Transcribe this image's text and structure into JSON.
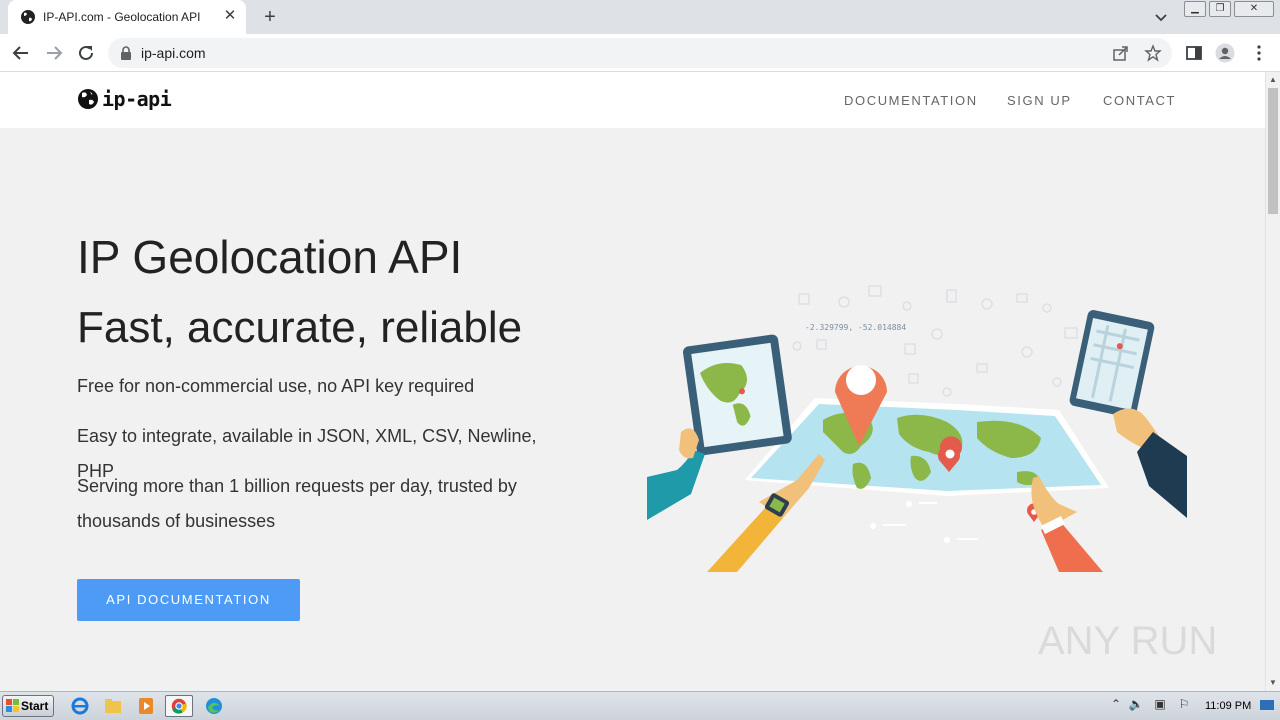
{
  "browser": {
    "tab_title": "IP-API.com - Geolocation API",
    "tab_close": "✕",
    "new_tab": "+",
    "url": "ip-api.com"
  },
  "site": {
    "logo_text": "ip-api",
    "nav": [
      "DOCUMENTATION",
      "SIGN UP",
      "CONTACT"
    ],
    "hero_title": "IP Geolocation API",
    "hero_subtitle": "Fast, accurate, reliable",
    "features": [
      "Free for non-commercial use, no API key required",
      "Easy to integrate, available in JSON, XML, CSV, Newline, PHP",
      "Serving more than 1 billion requests per day, trusted by thousands of businesses"
    ],
    "cta_label": "API DOCUMENTATION",
    "illustration_coords": "-2.329799, -52.014884"
  },
  "taskbar": {
    "start_label": "Start",
    "clock": "11:09 PM"
  },
  "watermark": "ANY RUN",
  "colors": {
    "accent_button": "#4e9bf5",
    "page_bg": "#f1f1f1",
    "map_green": "#8cb84a",
    "pin_orange": "#ee7b56"
  }
}
